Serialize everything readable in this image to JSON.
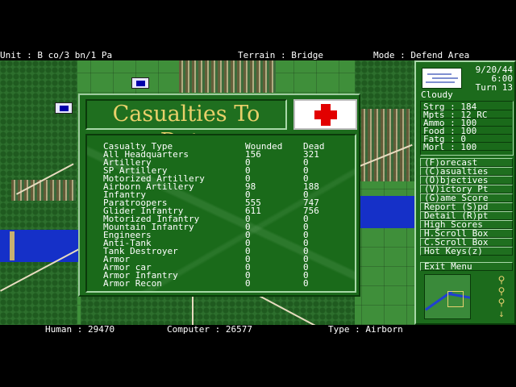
{
  "topbar": {
    "unit": "Unit : B co/3 bn/1 Pa",
    "terrain": "Terrain : Bridge",
    "mode": "Mode : Defend Area"
  },
  "dialog": {
    "title": "Casualties To Date",
    "headers": {
      "type": "Casualty Type",
      "wounded": "Wounded",
      "dead": "Dead"
    },
    "rows": [
      {
        "type": "All Headquarters",
        "wounded": "156",
        "dead": "321"
      },
      {
        "type": "Artillery",
        "wounded": "0",
        "dead": "0"
      },
      {
        "type": "SP Artillery",
        "wounded": "0",
        "dead": "0"
      },
      {
        "type": "Motorized Artillery",
        "wounded": "0",
        "dead": "0"
      },
      {
        "type": "Airborn Artillery",
        "wounded": "98",
        "dead": "188"
      },
      {
        "type": "Infantry",
        "wounded": "0",
        "dead": "0"
      },
      {
        "type": "Paratroopers",
        "wounded": "555",
        "dead": "747"
      },
      {
        "type": "Glider Infantry",
        "wounded": "611",
        "dead": "756"
      },
      {
        "type": "Motorized Infantry",
        "wounded": "0",
        "dead": "0"
      },
      {
        "type": "Mountain Infantry",
        "wounded": "0",
        "dead": "0"
      },
      {
        "type": "Engineers",
        "wounded": "0",
        "dead": "0"
      },
      {
        "type": "Anti-Tank",
        "wounded": "0",
        "dead": "0"
      },
      {
        "type": "Tank Destroyer",
        "wounded": "0",
        "dead": "0"
      },
      {
        "type": "Armor",
        "wounded": "0",
        "dead": "0"
      },
      {
        "type": "Armor car",
        "wounded": "0",
        "dead": "0"
      },
      {
        "type": "Armor Infantry",
        "wounded": "0",
        "dead": "0"
      },
      {
        "type": "Armor Recon",
        "wounded": "0",
        "dead": "0"
      }
    ]
  },
  "side": {
    "date": "9/20/44",
    "time": "6:00",
    "turn": "Turn 13",
    "weather": "Cloudy",
    "stats": [
      "Strg : 184",
      "Mpts : 12 RC",
      "Ammo : 100",
      "Food : 100",
      "Fatg : 0",
      "Morl : 100"
    ],
    "menu": [
      "(F)orecast",
      "(C)asualties",
      "(O)bjectives",
      "(V)ictory Pt",
      "(G)ame Score",
      "Report (S)pd",
      "Detail (R)pt",
      "High Scores",
      "H.Scroll Box",
      "C.Scroll Box",
      "Hot Keys(z)",
      "Exit Menu"
    ]
  },
  "bottombar": {
    "human": "Human : 29470",
    "computer": "Computer : 26577",
    "type": "Type : Airborn"
  },
  "colors": {
    "panel_green": "#1c6b1c",
    "title_gold": "#e9d06a",
    "cross_red": "#e20000",
    "river_blue": "#1530c8"
  }
}
